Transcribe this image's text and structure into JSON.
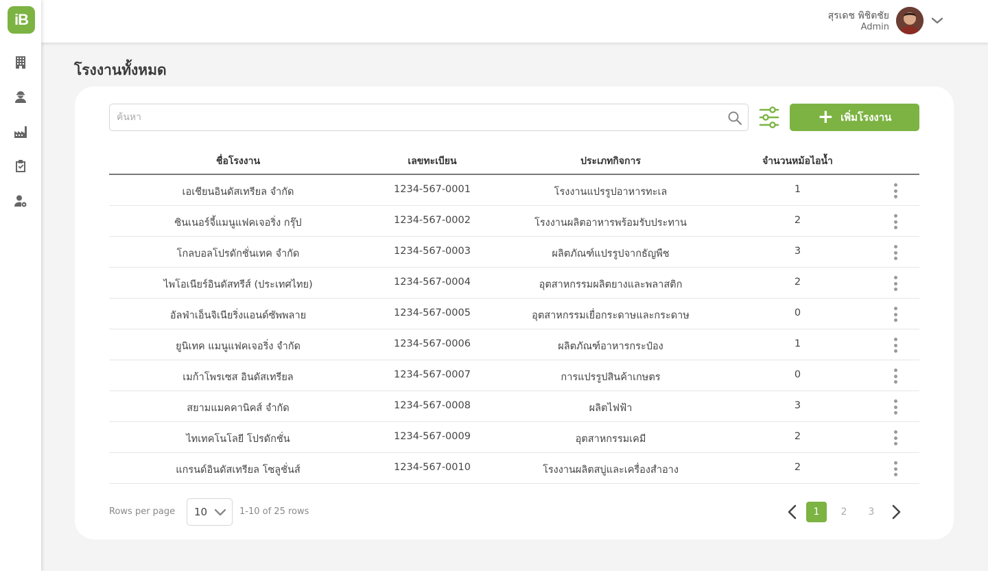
{
  "app": {
    "logo_text": "iB",
    "accent_color": "#7cb342"
  },
  "sidebar": {
    "items": [
      {
        "icon": "building-icon"
      },
      {
        "icon": "worker-icon"
      },
      {
        "icon": "factory-icon"
      },
      {
        "icon": "clipboard-check-icon"
      },
      {
        "icon": "user-settings-icon"
      }
    ]
  },
  "header": {
    "user_name": "สุรเดช พิชิตชัย",
    "user_role": "Admin"
  },
  "page": {
    "title": "โรงงานทั้งหมด"
  },
  "toolbar": {
    "search_placeholder": "ค้นหา",
    "add_label": "เพิ่มโรงงาน",
    "add_icon": "+"
  },
  "table": {
    "headers": [
      "ชื่อโรงงาน",
      "เลขทะเบียน",
      "ประเภทกิจการ",
      "จำนวนหม้อไอน้ำ"
    ],
    "rows": [
      [
        "เอเชียนอินดัสเทรียล จำกัด",
        "1234-567-0001",
        "โรงงานแปรรูปอาหารทะเล",
        "1"
      ],
      [
        "ซินเนอร์จี้แมนูแฟคเจอริ่ง กรุ๊ป",
        "1234-567-0002",
        "โรงงานผลิตอาหารพร้อมรับประทาน",
        "2"
      ],
      [
        "โกลบอลโปรดักชั่นเทค จำกัด",
        "1234-567-0003",
        "ผลิตภัณฑ์แปรรูปจากธัญพืช",
        "3"
      ],
      [
        "ไพโอเนียร์อินดัสทรีส์ (ประเทศไทย)",
        "1234-567-0004",
        "อุตสาหกรรมผลิตยางและพลาสติก",
        "2"
      ],
      [
        "อัลฟ่าเอ็นจิเนียริ่งแอนด์ซัพพลาย",
        "1234-567-0005",
        "อุตสาหกรรมเยื่อกระดาษและกระดาษ",
        "0"
      ],
      [
        "ยูนิเทค แมนูแฟคเจอริ่ง จำกัด",
        "1234-567-0006",
        "ผลิตภัณฑ์อาหารกระป๋อง",
        "1"
      ],
      [
        "เมก้าโพรเซส อินดัสเทรียล",
        "1234-567-0007",
        "การแปรรูปสินค้าเกษตร",
        "0"
      ],
      [
        "สยามแมคคานิคส์ จำกัด",
        "1234-567-0008",
        "ผลิตไฟฟ้า",
        "3"
      ],
      [
        "ไทเทคโนโลยี โปรดักชั่น",
        "1234-567-0009",
        "อุตสาหกรรมเคมี",
        "2"
      ],
      [
        "แกรนด์อินดัสเทรียล โซลูชั่นส์",
        "1234-567-0010",
        "โรงงานผลิตสบู่และเครื่องสำอาง",
        "2"
      ]
    ]
  },
  "pagination": {
    "rows_label": "Rows per page",
    "rows_value": "10",
    "range_text": "1-10 of 25 rows",
    "pages": [
      "1",
      "2",
      "3"
    ],
    "current_page": "1"
  }
}
